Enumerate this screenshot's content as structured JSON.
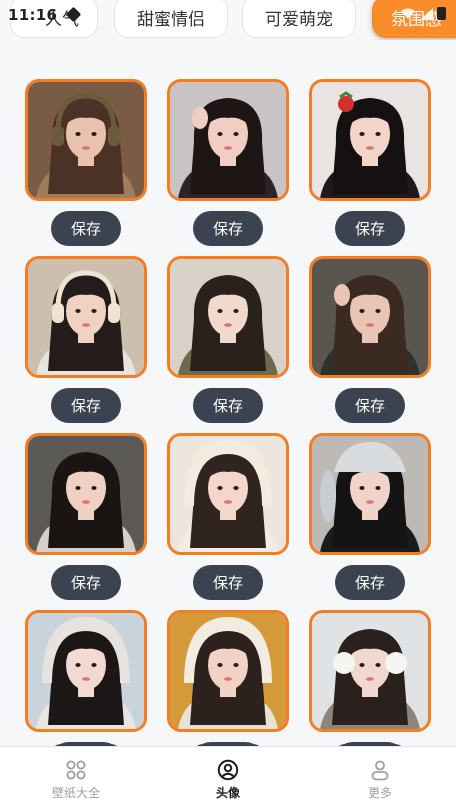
{
  "status_bar": {
    "time": "11:16"
  },
  "categories": [
    {
      "label": "人气",
      "active": false
    },
    {
      "label": "甜蜜情侣",
      "active": false
    },
    {
      "label": "可爱萌宠",
      "active": false
    },
    {
      "label": "氛围感",
      "active": true
    }
  ],
  "avatars": {
    "save_label": "保存",
    "items": [
      {
        "hair": "#4a3326",
        "skin": "#e9c2ad",
        "bg": "#7a5b45",
        "cloth": "#a07c5a",
        "accessory": "headphones-dark"
      },
      {
        "hair": "#1e1614",
        "skin": "#f0cfc2",
        "bg": "#c9c3c6",
        "cloth": "#2b2428",
        "accessory": "peace-sign"
      },
      {
        "hair": "#151112",
        "skin": "#f2d4c8",
        "bg": "#e9e4e2",
        "cloth": "#1c1a1b",
        "accessory": "strawberry"
      },
      {
        "hair": "#231c1a",
        "skin": "#efd2c2",
        "bg": "#cdbfae",
        "cloth": "#e8e3de",
        "accessory": "headphones-cream"
      },
      {
        "hair": "#2a201c",
        "skin": "#f3d8cc",
        "bg": "#d8d2c8",
        "cloth": "#6b6a4c",
        "accessory": "braid"
      },
      {
        "hair": "#3b2a22",
        "skin": "#e8c6b3",
        "bg": "#58564f",
        "cloth": "#2f312e",
        "accessory": "hand"
      },
      {
        "hair": "#1a1513",
        "skin": "#f1d0c4",
        "bg": "#5b5a57",
        "cloth": "#d7cfc9",
        "accessory": "none"
      },
      {
        "hair": "#2f2420",
        "skin": "#f4d6cb",
        "bg": "#ece6dc",
        "cloth": "#f1ede6",
        "accessory": "hood"
      },
      {
        "hair": "#161314",
        "skin": "#f0d4c9",
        "bg": "#bdb9b5",
        "cloth": "#1c1b1c",
        "accessory": "bunny-hat"
      },
      {
        "hair": "#1b1716",
        "skin": "#f3dad0",
        "bg": "#c8d3dc",
        "cloth": "#e9e6e0",
        "accessory": "snow-hood"
      },
      {
        "hair": "#2c211c",
        "skin": "#f2d2c4",
        "bg": "#d49a3a",
        "cloth": "#e9e2d4",
        "accessory": "fur-hat"
      },
      {
        "hair": "#2a211f",
        "skin": "#f1d8cf",
        "bg": "#dfe3e6",
        "cloth": "#8c8579",
        "accessory": "earmuffs"
      }
    ]
  },
  "bottom_nav": [
    {
      "label": "壁纸大全",
      "icon": "grid-icon",
      "active": false
    },
    {
      "label": "头像",
      "icon": "user-circle-icon",
      "active": true
    },
    {
      "label": "更多",
      "icon": "person-icon",
      "active": false
    }
  ],
  "colors": {
    "accent": "#f47d24",
    "button_bg": "#3b4250",
    "active_tab_bg": "#fa8c2a"
  }
}
